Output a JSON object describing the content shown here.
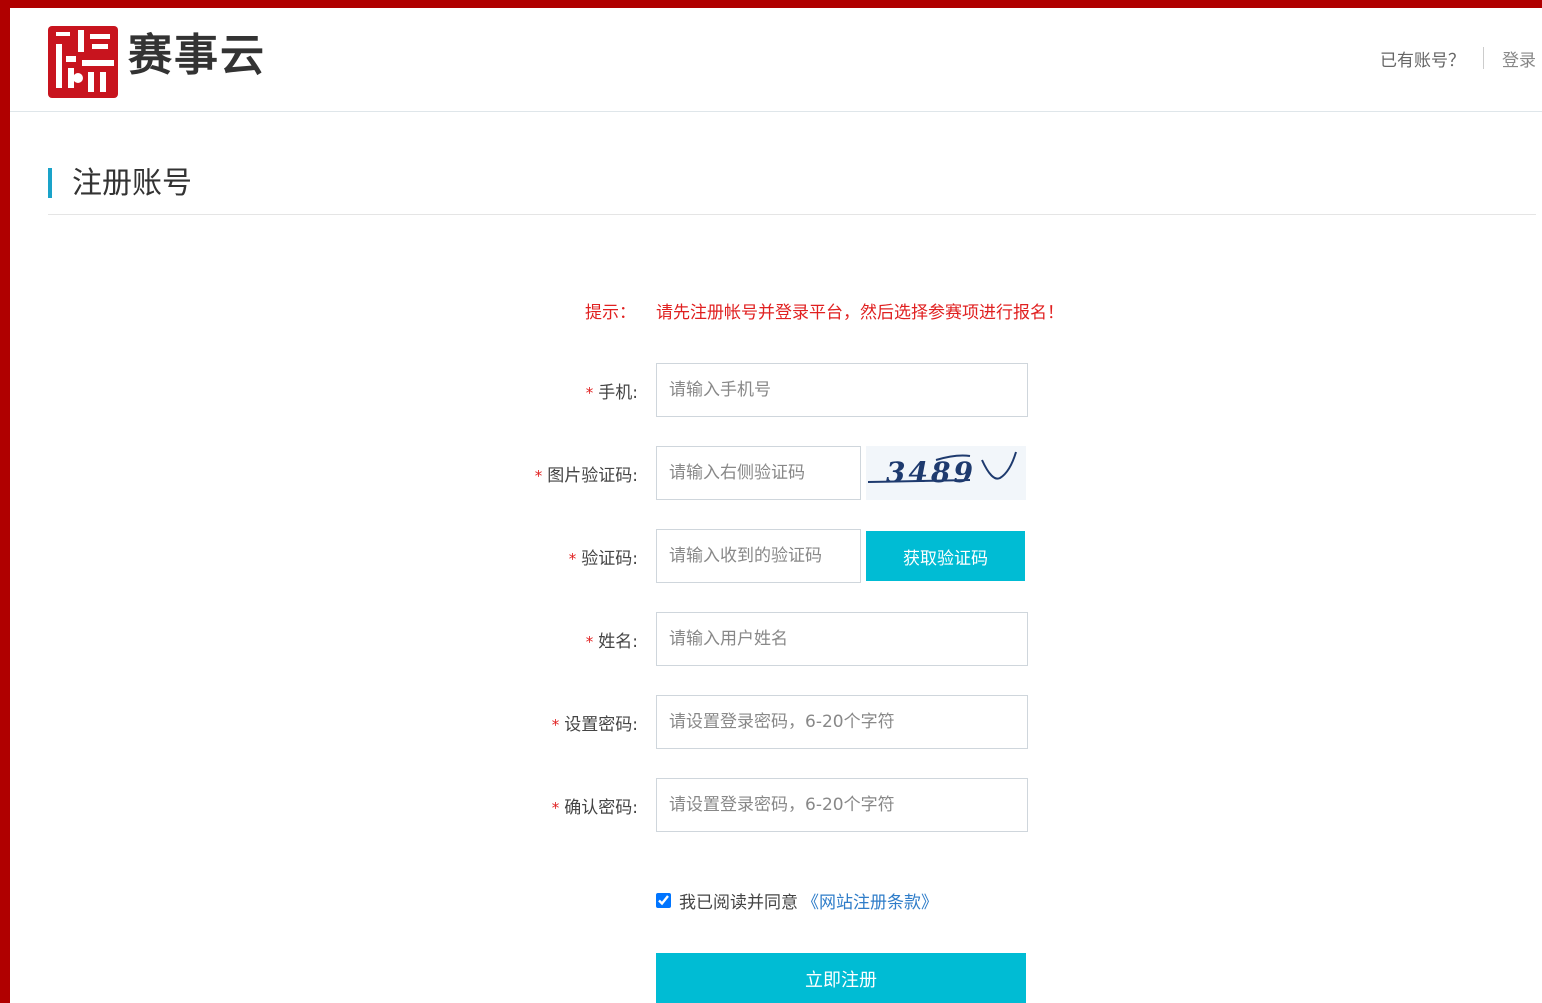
{
  "header": {
    "logo_text": "赛事云",
    "have_account": "已有账号？",
    "login_link": "登录"
  },
  "section": {
    "title": "注册账号"
  },
  "tip": {
    "label": "提示：",
    "text": "请先注册帐号并登录平台，然后选择参赛项进行报名！"
  },
  "form": {
    "required_mark": "*",
    "phone": {
      "label": "手机:",
      "placeholder": "请输入手机号"
    },
    "image_code": {
      "label": "图片验证码:",
      "placeholder": "请输入右侧验证码",
      "captcha_text": "3489"
    },
    "sms_code": {
      "label": "验证码:",
      "placeholder": "请输入收到的验证码",
      "button": "获取验证码"
    },
    "name": {
      "label": "姓名:",
      "placeholder": "请输入用户姓名"
    },
    "password": {
      "label": "设置密码:",
      "placeholder": "请设置登录密码，6-20个字符"
    },
    "confirm_password": {
      "label": "确认密码:",
      "placeholder": "请设置登录密码，6-20个字符"
    },
    "agreement": {
      "text": "我已阅读并同意",
      "link": "《网站注册条款》",
      "checked": true
    },
    "submit": "立即注册"
  },
  "colors": {
    "accent": "#00bcd4",
    "tip_red": "#e02020",
    "frame_red": "#b00000",
    "link_blue": "#2f7dc9"
  }
}
